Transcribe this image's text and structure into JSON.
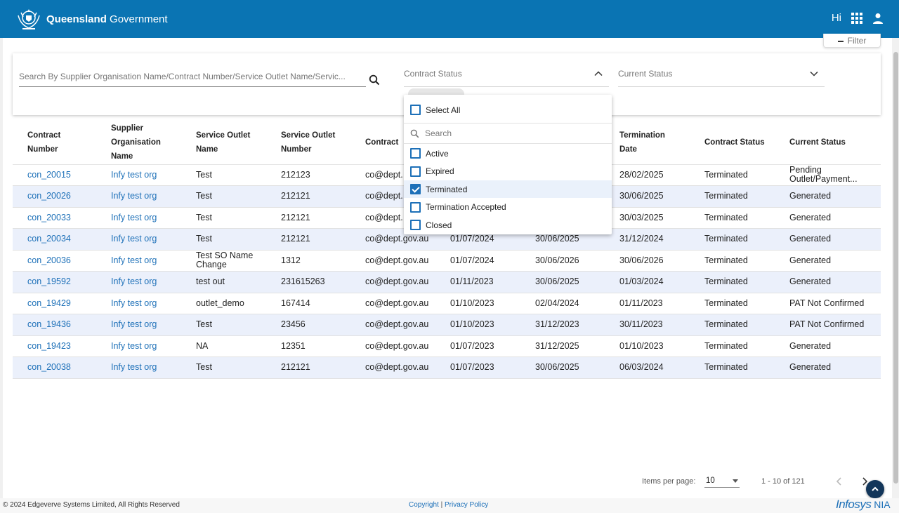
{
  "header": {
    "brand_bold": "Queensland",
    "brand_rest": " Government",
    "greeting": "Hi",
    "icons": [
      "queensland-crest-icon",
      "apps-grid-icon",
      "user-icon"
    ]
  },
  "filter_button": {
    "label": "Filter"
  },
  "filters": {
    "search_placeholder": "Search By Supplier Organisation Name/Contract Number/Service Outlet Name/Servic...",
    "contract_status_label": "Contract Status",
    "current_status_label": "Current Status"
  },
  "dropdown": {
    "select_all": "Select All",
    "search_placeholder": "Search",
    "options": [
      {
        "label": "Active",
        "checked": false
      },
      {
        "label": "Expired",
        "checked": false
      },
      {
        "label": "Terminated",
        "checked": true
      },
      {
        "label": "Termination Accepted",
        "checked": false
      },
      {
        "label": "Closed",
        "checked": false
      }
    ]
  },
  "table": {
    "columns": [
      [
        "Contract",
        "Number"
      ],
      [
        "Supplier",
        "Organisation",
        "Name"
      ],
      [
        "Service Outlet",
        "Name"
      ],
      [
        "Service Outlet",
        "Number"
      ],
      [
        "Contract"
      ],
      [
        ""
      ],
      [
        ""
      ],
      [
        "Termination",
        "Date"
      ],
      [
        "Contract Status"
      ],
      [
        "Current Status"
      ]
    ],
    "rows": [
      [
        "con_20015",
        "Infy test org",
        "Test",
        "212123",
        "co@dept.",
        "",
        "",
        "28/02/2025",
        "Terminated",
        "Pending Outlet/Payment..."
      ],
      [
        "con_20026",
        "Infy test org",
        "Test",
        "212121",
        "co@dept.",
        "",
        "",
        "30/06/2025",
        "Terminated",
        "Generated"
      ],
      [
        "con_20033",
        "Infy test org",
        "Test",
        "212121",
        "co@dept.",
        "",
        "",
        "30/03/2025",
        "Terminated",
        "Generated"
      ],
      [
        "con_20034",
        "Infy test org",
        "Test",
        "212121",
        "co@dept.gov.au",
        "01/07/2024",
        "30/06/2025",
        "31/12/2024",
        "Terminated",
        "Generated"
      ],
      [
        "con_20036",
        "Infy test org",
        "Test SO Name Change",
        "1312",
        "co@dept.gov.au",
        "01/07/2024",
        "30/06/2026",
        "30/06/2026",
        "Terminated",
        "Generated"
      ],
      [
        "con_19592",
        "Infy test org",
        "test out",
        "231615263",
        "co@dept.gov.au",
        "01/11/2023",
        "30/06/2025",
        "01/03/2024",
        "Terminated",
        "Generated"
      ],
      [
        "con_19429",
        "Infy test org",
        "outlet_demo",
        "167414",
        "co@dept.gov.au",
        "01/10/2023",
        "02/04/2024",
        "01/11/2023",
        "Terminated",
        "PAT Not Confirmed"
      ],
      [
        "con_19436",
        "Infy test org",
        "Test",
        "23456",
        "co@dept.gov.au",
        "01/10/2023",
        "31/12/2023",
        "30/11/2023",
        "Terminated",
        "PAT Not Confirmed"
      ],
      [
        "con_19423",
        "Infy test org",
        "NA",
        "12351",
        "co@dept.gov.au",
        "01/07/2023",
        "31/12/2025",
        "01/10/2023",
        "Terminated",
        "Generated"
      ],
      [
        "con_20038",
        "Infy test org",
        "Test",
        "212121",
        "co@dept.gov.au",
        "01/07/2023",
        "30/06/2025",
        "06/03/2024",
        "Terminated",
        "Generated"
      ]
    ]
  },
  "pager": {
    "items_per_page_label": "Items per page:",
    "items_per_page_value": "10",
    "range": "1 - 10 of 121"
  },
  "footer": {
    "copyright": "© 2024 Edgeverve Systems Limited, All Rights Reserved",
    "copyright_link": "Copyright",
    "separator": " | ",
    "privacy_link": "Privacy Policy",
    "logo_main": "Infosys",
    "logo_suffix": " NIA"
  },
  "colors": {
    "header": "#0a74b3",
    "link": "#1d70b8",
    "row_alt": "#ebf0fb",
    "back_to_top": "#13365a"
  }
}
